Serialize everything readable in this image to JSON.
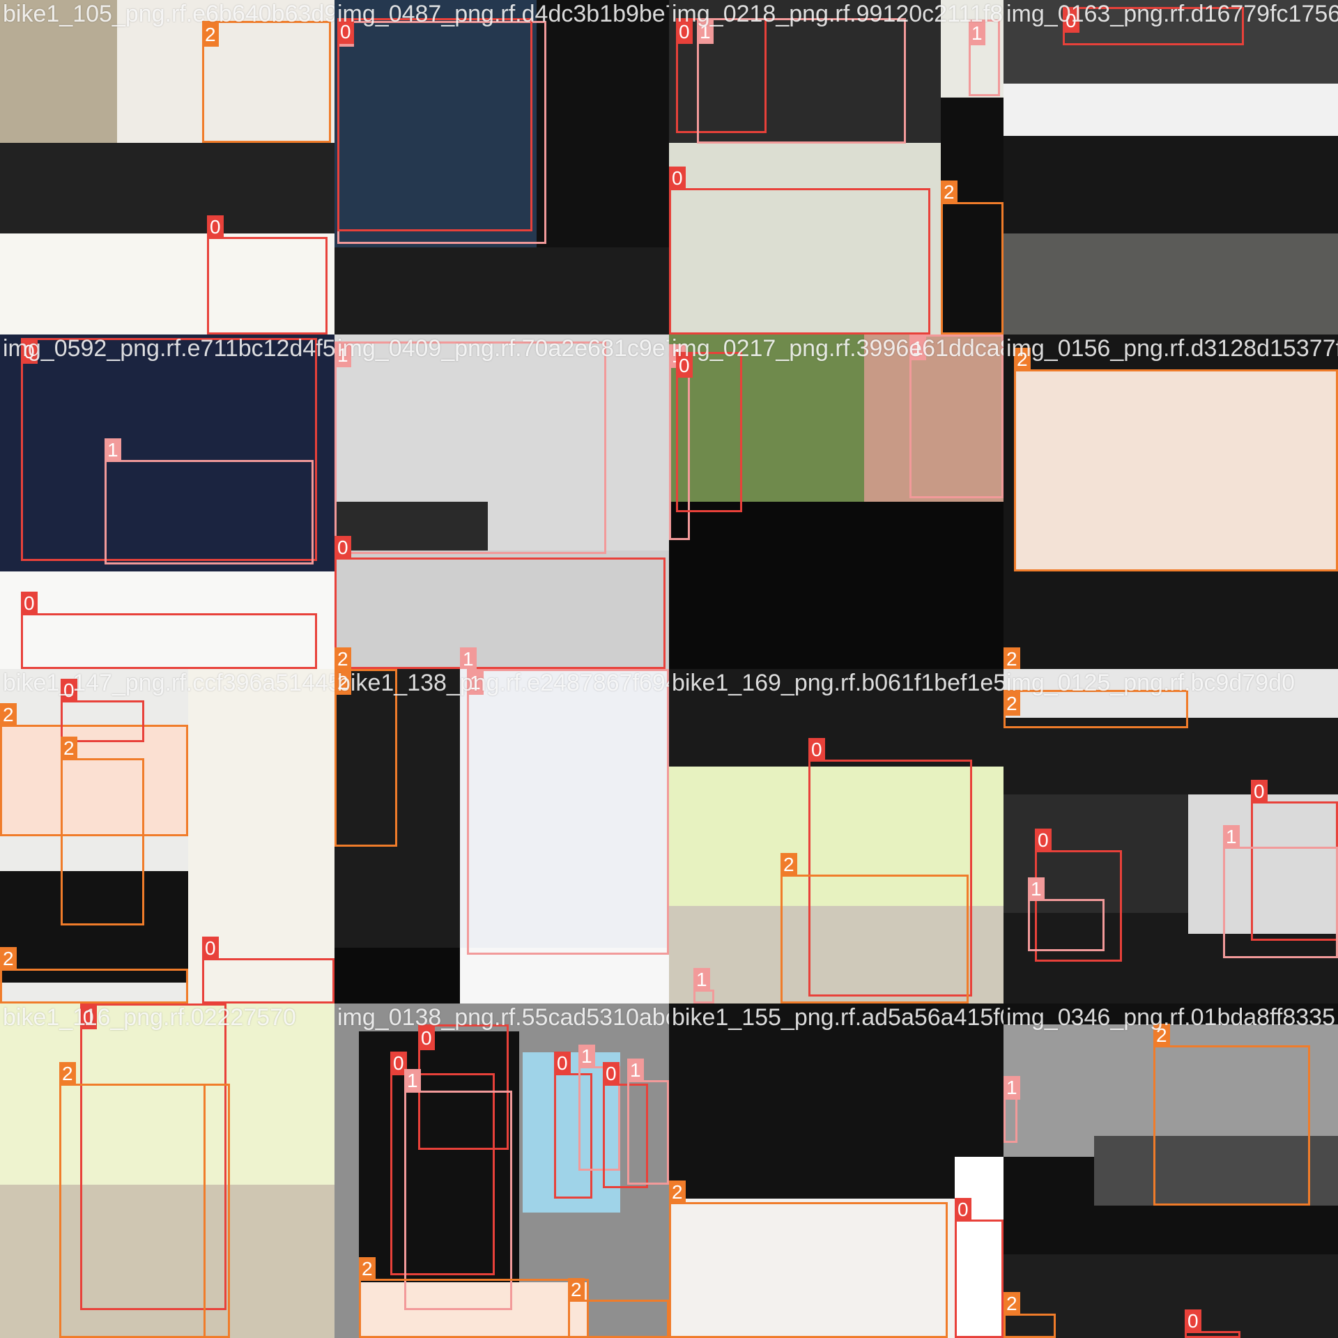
{
  "class_colors": {
    "0": "#e8413a",
    "1": "#f29a9a",
    "2": "#f07c2a"
  },
  "tiles": [
    {
      "filename": "bike1_105_png.rf.e6b640b63d9b487e847d1f28ad3d291c",
      "bg": "#efece6",
      "regions": [
        {
          "color": "#b7ac95"
        },
        {
          "color": "#222222"
        },
        {
          "color": "#f7f6f1"
        }
      ],
      "boxes": [
        {
          "cls": "2"
        },
        {
          "cls": "0"
        }
      ]
    },
    {
      "filename": "img_0487_png.rf.d4dc3b1b9be77a3ad4e3d218f5c6a2e1",
      "bg": "#e6e3de",
      "regions": [
        {
          "color": "#25384f"
        },
        {
          "color": "#111111"
        },
        {
          "color": "#1c1c1c"
        }
      ],
      "boxes": [
        {
          "cls": "1"
        },
        {
          "cls": "0"
        }
      ]
    },
    {
      "filename": "img_0218_png.rf.99120c2111f88c1d0b2e3f4a5b6c7d8e",
      "bg": "#e9e9e2",
      "regions": [
        {
          "color": "#2b2b2b"
        },
        {
          "color": "#dcded2"
        },
        {
          "color": "#0f0f0f"
        }
      ],
      "boxes": [
        {
          "cls": "0"
        },
        {
          "cls": "1"
        },
        {
          "cls": "1"
        },
        {
          "cls": "0"
        },
        {
          "cls": "2"
        }
      ]
    },
    {
      "filename": "img_0163_png.rf.d16779fc17562e8379",
      "bg": "#f1f1f1",
      "regions": [
        {
          "color": "#3d3d3d"
        },
        {
          "color": "#171717"
        },
        {
          "color": "#5b5b58"
        }
      ],
      "boxes": [
        {
          "cls": "0"
        }
      ]
    },
    {
      "filename": "img_0592_png.rf.e711bc12d4f5a6b7c8d9e0f1a2b3c4d5",
      "bg": "#f0efea",
      "regions": [
        {
          "color": "#1b2440"
        },
        {
          "color": "#f8f8f6"
        }
      ],
      "boxes": [
        {
          "cls": "0"
        },
        {
          "cls": "1"
        },
        {
          "cls": "0"
        }
      ]
    },
    {
      "filename": "img_0409_png.rf.70a2e681c9e7b1d4c2a5f6e8d9b0a1c3",
      "bg": "#f4f4f4",
      "regions": [
        {
          "color": "#d9d9d9"
        },
        {
          "color": "#2a2a2a"
        },
        {
          "color": "#cfcfcf"
        }
      ],
      "boxes": [
        {
          "cls": "1"
        },
        {
          "cls": "0"
        },
        {
          "cls": "2"
        },
        {
          "cls": "1"
        }
      ]
    },
    {
      "filename": "img_0217_png.rf.3996e61ddca8457c02186aa93f4b5d1e",
      "bg": "#0d0d0d",
      "regions": [
        {
          "color": "#6f8a4c"
        },
        {
          "color": "#c89a86"
        },
        {
          "color": "#0a0a0a"
        }
      ],
      "boxes": [
        {
          "cls": "1"
        },
        {
          "cls": "1"
        },
        {
          "cls": "0"
        }
      ]
    },
    {
      "filename": "img_0156_png.rf.d3128d15377f6",
      "bg": "#161616",
      "regions": [
        {
          "color": "#f3e2d6"
        },
        {
          "color": "#161616"
        }
      ],
      "boxes": [
        {
          "cls": "2"
        },
        {
          "cls": "2"
        }
      ]
    },
    {
      "filename": "bike1_147_png.rf.ccf396a514456",
      "bg": "#ececea",
      "regions": [
        {
          "color": "#fbe0d2"
        },
        {
          "color": "#121212"
        },
        {
          "color": "#f4f2ea"
        }
      ],
      "boxes": [
        {
          "cls": "2"
        },
        {
          "cls": "0"
        },
        {
          "cls": "2"
        },
        {
          "cls": "2"
        },
        {
          "cls": "0"
        }
      ]
    },
    {
      "filename": "bike1_138_png.rf.e2487867f694342",
      "bg": "#f7f7f7",
      "regions": [
        {
          "color": "#1c1c1c"
        },
        {
          "color": "#eef0f4"
        },
        {
          "color": "#0b0b0b"
        }
      ],
      "boxes": [
        {
          "cls": "2"
        },
        {
          "cls": "1"
        }
      ]
    },
    {
      "filename": "bike1_169_png.rf.b061f1bef1e5b",
      "bg": "#f5f2e8",
      "regions": [
        {
          "color": "#1a1a1a"
        },
        {
          "color": "#e7f2c0"
        },
        {
          "color": "#cfc9ba"
        }
      ],
      "boxes": [
        {
          "cls": "0"
        },
        {
          "cls": "2"
        },
        {
          "cls": "1"
        }
      ]
    },
    {
      "filename": "img_0125_png.rf.bc9d79d0",
      "bg": "#1a1a1a",
      "regions": [
        {
          "color": "#e7e7e7"
        },
        {
          "color": "#2c2c2c"
        },
        {
          "color": "#dadada"
        }
      ],
      "boxes": [
        {
          "cls": "2"
        },
        {
          "cls": "0"
        },
        {
          "cls": "0"
        },
        {
          "cls": "1"
        },
        {
          "cls": "1"
        }
      ]
    },
    {
      "filename": "bike1_116_png.rf.02227570",
      "bg": "#f4f3ef",
      "regions": [
        {
          "color": "#eef3cf"
        },
        {
          "color": "#cfc6b2"
        }
      ],
      "boxes": [
        {
          "cls": "0"
        },
        {
          "cls": "2"
        },
        {
          "cls": "2"
        }
      ]
    },
    {
      "filename": "img_0138_png.rf.55cad5310abc145",
      "bg": "#8f8f8f",
      "regions": [
        {
          "color": "#111111"
        },
        {
          "color": "#9fd3e8"
        },
        {
          "color": "#fbe6d8"
        }
      ],
      "boxes": [
        {
          "cls": "0"
        },
        {
          "cls": "0"
        },
        {
          "cls": "1"
        },
        {
          "cls": "0"
        },
        {
          "cls": "1"
        },
        {
          "cls": "0"
        },
        {
          "cls": "1"
        },
        {
          "cls": "2"
        },
        {
          "cls": "2"
        }
      ]
    },
    {
      "filename": "bike1_155_png.rf.ad5a56a415f03765",
      "bg": "#121212",
      "regions": [
        {
          "color": "#f3f1ee"
        },
        {
          "color": "#ffffff"
        }
      ],
      "boxes": [
        {
          "cls": "2"
        },
        {
          "cls": "0"
        }
      ]
    },
    {
      "filename": "img_0346_png.rf.01bda8ff8335",
      "bg": "#101010",
      "regions": [
        {
          "color": "#9b9b9b"
        },
        {
          "color": "#4a4a4a"
        },
        {
          "color": "#1e1e1e"
        }
      ],
      "boxes": [
        {
          "cls": "2"
        },
        {
          "cls": "1"
        },
        {
          "cls": "2"
        },
        {
          "cls": "0"
        }
      ]
    }
  ]
}
